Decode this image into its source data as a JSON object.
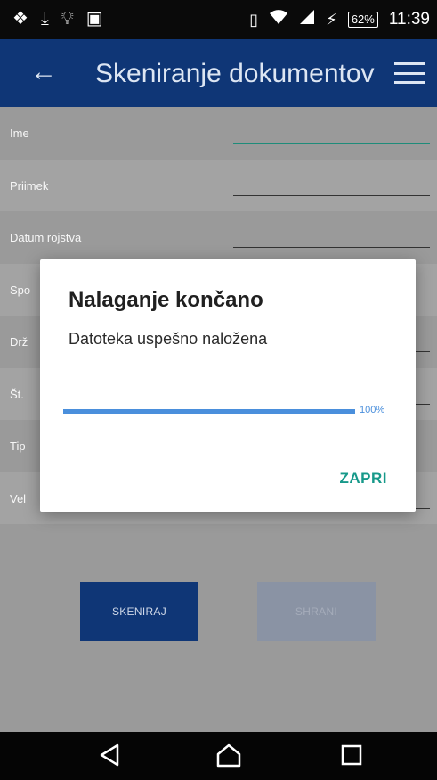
{
  "status_bar": {
    "left_icons": [
      "dropbox-icon",
      "download-icon",
      "bulb-icon",
      "android-icon"
    ],
    "battery": "62%",
    "time": "11:39"
  },
  "app_bar": {
    "title": "Skeniranje dokumentov",
    "back_icon": "arrow-left-icon",
    "menu_icon": "hamburger-menu-icon"
  },
  "form": {
    "fields": [
      {
        "label": "Ime",
        "value": ""
      },
      {
        "label": "Priimek",
        "value": ""
      },
      {
        "label": "Datum rojstva",
        "value": ""
      },
      {
        "label": "Spo",
        "value": ""
      },
      {
        "label": "Drž",
        "value": ""
      },
      {
        "label": "Št.",
        "value": ""
      },
      {
        "label": "Tip",
        "value": ""
      },
      {
        "label": "Vel",
        "value": ""
      }
    ]
  },
  "buttons": {
    "scan": "SKENIRAJ",
    "save": "SHRANI"
  },
  "dialog": {
    "title": "Nalaganje končano",
    "message": "Datoteka uspešno naložena",
    "progress": 1.0,
    "progress_label": "100%",
    "action": "ZAPRI"
  },
  "colors": {
    "app_bar": "#0f3676",
    "accent": "#17998a",
    "progress": "#4a8fdc"
  }
}
